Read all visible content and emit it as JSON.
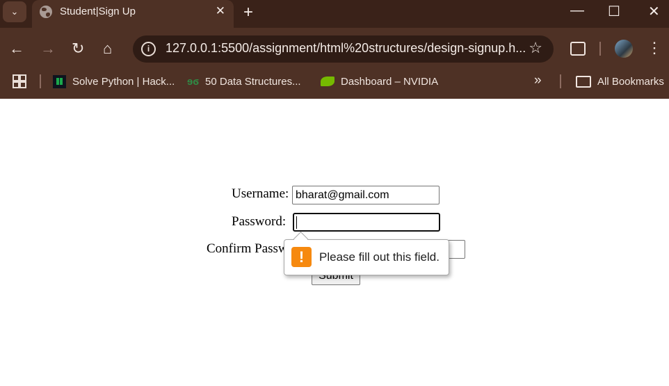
{
  "browser": {
    "tab": {
      "title": "Student|Sign Up",
      "close_glyph": "✕"
    },
    "new_tab_glyph": "+",
    "tab_search_glyph": "⌄",
    "window": {
      "minimize": "—",
      "maximize": "☐",
      "close": "✕"
    },
    "nav": {
      "back": "←",
      "forward": "→",
      "reload": "↻",
      "home": "⌂"
    },
    "address_bar": {
      "url": "127.0.0.1:5500/assignment/html%20structures/design-signup.h...",
      "info_glyph": "i",
      "star_glyph": "☆"
    },
    "menu_glyph": "⋮",
    "bookmarks": [
      {
        "label": "Solve Python | Hack...",
        "icon": "hackerrank-icon"
      },
      {
        "label": "50 Data Structures...",
        "icon": "geeksforgeeks-icon",
        "glyph": "ɘϭ"
      },
      {
        "label": "Dashboard – NVIDIA",
        "icon": "nvidia-icon"
      }
    ],
    "more_bookmarks_glyph": "»",
    "all_bookmarks": "All Bookmarks"
  },
  "form": {
    "username_label": "Username:",
    "username_value": "bharat@gmail.com",
    "password_label": "Password:",
    "password_value": "",
    "confirm_label": "Confirm Password:",
    "confirm_value": "",
    "submit_label": "Submit"
  },
  "validation": {
    "icon_glyph": "!",
    "message": "Please fill out this field."
  },
  "colors": {
    "titlebar": "#3a2219",
    "toolbar": "#4e3125",
    "omnibox": "#2f1c15",
    "warning": "#f6890f"
  }
}
